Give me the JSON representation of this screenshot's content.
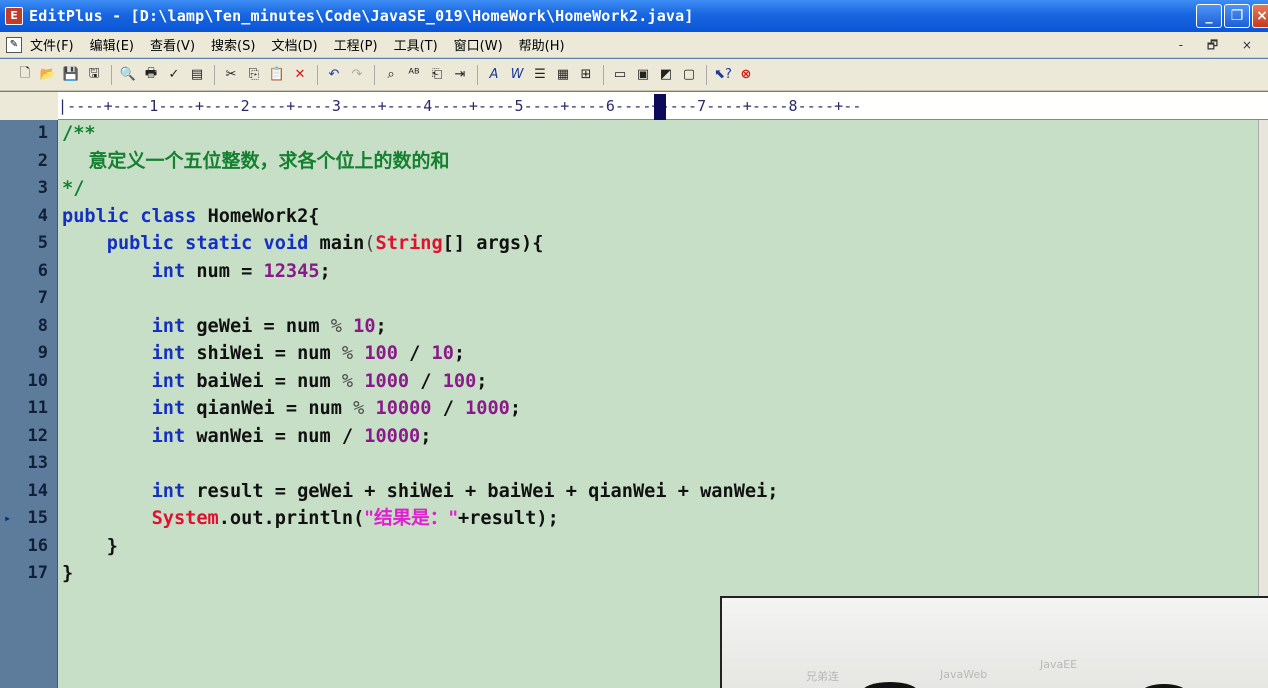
{
  "window": {
    "title": "EditPlus - [D:\\lamp\\Ten_minutes\\Code\\JavaSE_019\\HomeWork\\HomeWork2.java]",
    "app_icon_letter": "E"
  },
  "menu": {
    "items": [
      "文件(F)",
      "编辑(E)",
      "查看(V)",
      "搜索(S)",
      "文档(D)",
      "工程(P)",
      "工具(T)",
      "窗口(W)",
      "帮助(H)"
    ],
    "mini_controls": "- 🗗 ×"
  },
  "ruler": {
    "text": "|----+----1----+----2----+----3----+----4----+----5----+----6----+----7----+----8----+--"
  },
  "editor": {
    "marked_line": 15,
    "line_numbers": [
      "1",
      "2",
      "3",
      "4",
      "5",
      "6",
      "7",
      "8",
      "9",
      "10",
      "11",
      "12",
      "13",
      "14",
      "15",
      "16",
      "17"
    ]
  },
  "code": {
    "l1": "/**",
    "l2": "    意定义一个五位整数，求各个位上的数的和",
    "l3": "*/",
    "l4_kw1": "public",
    "l4_kw2": "class",
    "l4_rest": "HomeWork2{",
    "l5_kw1": "public",
    "l5_kw2": "static",
    "l5_kw3": "void",
    "l5_name": "main",
    "l5_cls": "String",
    "l5_rest": "[] args){",
    "l6_kw": "int",
    "l6_var": "num",
    "l6_num": "12345",
    "l8_kw": "int",
    "l8_var": "geWei",
    "l8_num": "10",
    "l9_kw": "int",
    "l9_var": "shiWei",
    "l9_n1": "100",
    "l9_n2": "10",
    "l10_kw": "int",
    "l10_var": "baiWei",
    "l10_n1": "1000",
    "l10_n2": "100",
    "l11_kw": "int",
    "l11_var": "qianWei",
    "l11_n1": "10000",
    "l11_n2": "1000",
    "l12_kw": "int",
    "l12_var": "wanWei",
    "l12_n1": "10000",
    "l14_kw": "int",
    "l14_rest": "result = geWei + shiWei + baiWei + qianWei + wanWei;",
    "l15_cls": "System",
    "l15_mid": ".out.println(",
    "l15_str": "\"结果是：\"",
    "l15_end": "+result);",
    "l16": "}",
    "l17": "}"
  },
  "overlay": {
    "labels": [
      "兄弟连",
      "JavaWeb",
      "JavaEE"
    ]
  }
}
